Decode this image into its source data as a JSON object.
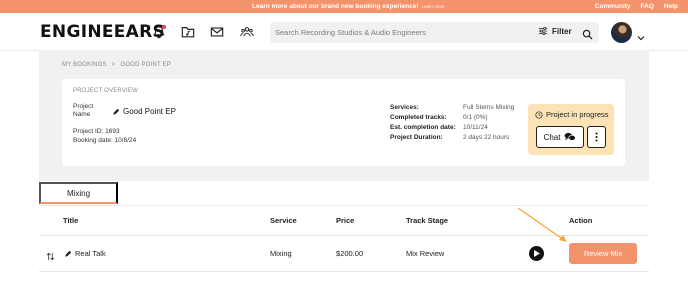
{
  "banner": {
    "message": "Learn more about our brand new booking experience!",
    "learn_more": "Learn more",
    "links": [
      "Community",
      "FAQ",
      "Help"
    ],
    "color": "#f2936b"
  },
  "nav": {
    "logo": "ENGINEEARS",
    "icons": [
      "bell-icon",
      "folder-music-icon",
      "mail-icon",
      "community-icon"
    ],
    "search": {
      "placeholder": "Search Recording Studios & Audio Engineers",
      "value": ""
    },
    "filter_label": "Filter"
  },
  "breadcrumb": {
    "root": "MY BOOKINGS",
    "separator": ">",
    "current": "GOOD POINT EP"
  },
  "overview": {
    "section_title": "PROJECT OVERVIEW",
    "project_name_label": "Project Name",
    "project_name": "Good Point EP",
    "project_id": "Project ID: 1693",
    "booking_date": "Booking date: 10/8/24",
    "info": [
      {
        "label": "Services:",
        "value": "Full Stems Mixing"
      },
      {
        "label": "Completed tracks:",
        "value": "0/1 (0%)"
      },
      {
        "label": "Est. completion date:",
        "value": "10/11/24"
      },
      {
        "label": "Project Duration:",
        "value": "2 days 22 hours"
      }
    ]
  },
  "status": {
    "label": "Project in progress",
    "chat_label": "Chat",
    "color": "#fbe3b5"
  },
  "tabs": [
    {
      "label": "Mixing",
      "active": true
    }
  ],
  "table": {
    "headers": {
      "title": "Title",
      "service": "Service",
      "price": "Price",
      "track_stage": "Track Stage",
      "action": "Action"
    },
    "rows": [
      {
        "title": "Real Talk",
        "service": "Mixing",
        "price": "$200.00",
        "track_stage": "Mix Review",
        "action_label": "Review Mix"
      }
    ]
  },
  "accent_color": "#f2936b"
}
